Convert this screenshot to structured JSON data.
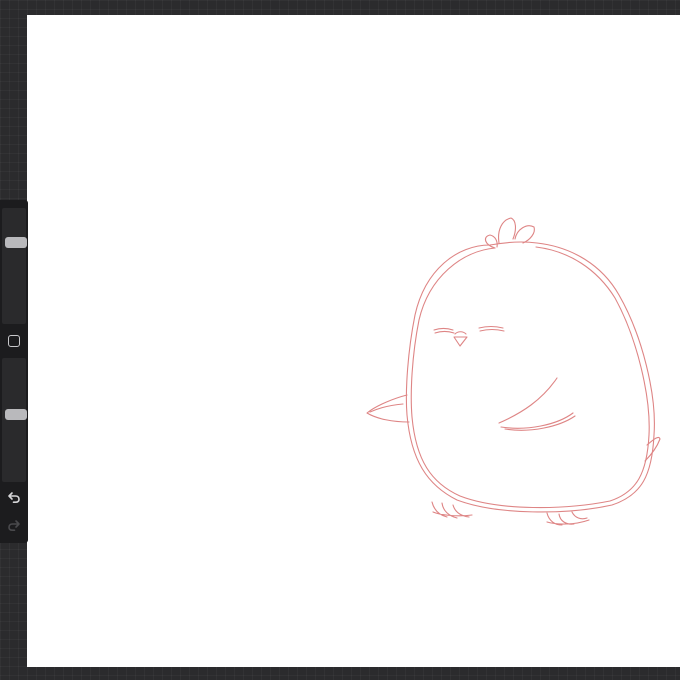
{
  "app": {
    "accent_color": "#d97070",
    "background_color": "#2b2b2d"
  },
  "canvas": {
    "sketch_subject": "chick-sketch",
    "stroke_color": "#d97070"
  },
  "sidebar": {
    "brush_size_slider": {
      "level": 0.72
    },
    "opacity_slider": {
      "level": 0.55
    },
    "modify_button": {
      "icon": "square-icon"
    },
    "undo_button": {
      "icon": "undo-icon",
      "enabled": true
    },
    "redo_button": {
      "icon": "redo-icon",
      "enabled": false
    }
  }
}
